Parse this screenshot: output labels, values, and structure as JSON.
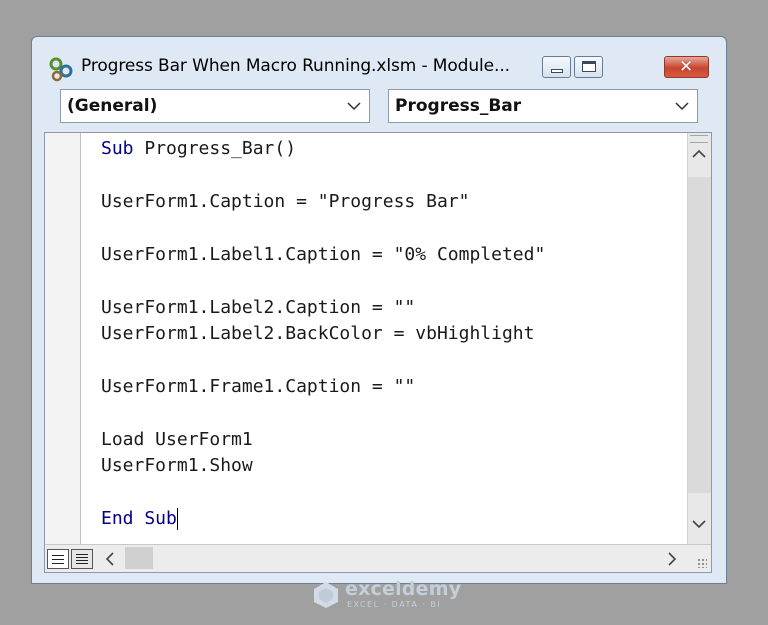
{
  "window": {
    "title": "Progress Bar When Macro Running.xlsm - Module...",
    "close_glyph": "✕"
  },
  "dropdowns": {
    "object": "(General)",
    "procedure": "Progress_Bar"
  },
  "code": {
    "lines": [
      {
        "keyword": "Sub",
        "text": " Progress_Bar()"
      },
      {
        "keyword": "",
        "text": "UserForm1.Caption = \"Progress Bar\""
      },
      {
        "keyword": "",
        "text": "UserForm1.Label1.Caption = \"0% Completed\""
      },
      {
        "keyword": "",
        "text": "UserForm1.Label2.Caption = \"\""
      },
      {
        "keyword": "",
        "text": "UserForm1.Label2.BackColor = vbHighlight"
      },
      {
        "keyword": "",
        "text": "UserForm1.Frame1.Caption = \"\""
      },
      {
        "keyword": "",
        "text": "Load UserForm1"
      },
      {
        "keyword": "",
        "text": "UserForm1.Show"
      },
      {
        "keyword": "End Sub",
        "text": ""
      }
    ]
  },
  "watermark": {
    "name": "exceldemy",
    "tagline": "EXCEL · DATA · BI"
  },
  "colors": {
    "keyword": "#00008b",
    "window_frame": "#dee9f5",
    "close_button": "#c7442f"
  }
}
